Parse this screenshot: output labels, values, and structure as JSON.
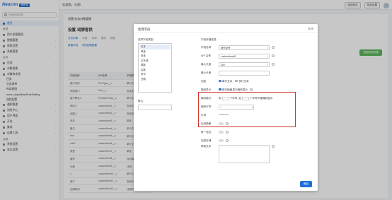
{
  "brand": {
    "logo": "Neocrm",
    "badge": "销售易"
  },
  "sidebar": {
    "search_placeholder": "快速搜索菜单",
    "items": [
      {
        "label": "首页",
        "active": true
      },
      {
        "group": "管理"
      },
      {
        "label": "用户权限管理"
      },
      {
        "label": "数据管理"
      },
      {
        "label": "审批设置"
      },
      {
        "label": "系统管理"
      },
      {
        "group": "定制"
      },
      {
        "label": "应用"
      },
      {
        "label": "对象管理"
      },
      {
        "label": "对象和字段"
      },
      {
        "label": "任务",
        "sub": true
      },
      {
        "label": "业务表单",
        "sub": true
      },
      {
        "label": "布局规则",
        "sub": true
      },
      {
        "label": "menu.objectMaxRuleSetting",
        "sub": true
      },
      {
        "label": "流程配置",
        "sub": true
      },
      {
        "label": "通知管理"
      },
      {
        "label": "消息中心"
      },
      {
        "label": "用户界面"
      },
      {
        "label": "开发"
      },
      {
        "label": "集成"
      },
      {
        "label": "运营工具"
      },
      {
        "group": "设置"
      },
      {
        "label": "系统设置"
      },
      {
        "label": "安全设置"
      }
    ]
  },
  "topbar": {
    "welcome": "欢迎您，小屁!",
    "btn1": "返回首页",
    "btn2": "系统设置"
  },
  "page": {
    "breadcrumb": "设置\\业务对象管理",
    "title": "设置-词牌客供",
    "tabs": [
      "业务对象",
      "字段",
      "布局",
      "规则",
      "按钮"
    ],
    "actions": [
      "新建字段",
      "字段依赖配置"
    ],
    "green_button": "数据权限设置",
    "table_head": [
      "字段名称",
      "API名称",
      "字段类型"
    ],
    "rows": [
      [
        "客户名称",
        "PhoType__c",
        "单行文本"
      ],
      [
        "所属部门",
        "Part__c",
        "查找关系"
      ],
      [
        "客户联系人",
        "PhoNumField__c",
        "单行文本"
      ],
      [
        "修改人",
        "customItem1__c",
        "查找关系"
      ],
      [
        "创建人",
        "customItem2__c",
        "查找关系"
      ],
      [
        "状态",
        "customItem3__c",
        "单选"
      ],
      [
        "备注",
        "customItem4__c",
        "多行文本"
      ],
      [
        "text",
        "customItem5__c",
        "单行文本"
      ],
      [
        "Inkr2",
        "customItem6__c",
        "单行文本"
      ],
      [
        "类型",
        "customItem7__c",
        "单选"
      ],
      [
        "编号",
        "customItem8__c",
        "自动编号"
      ],
      [
        "日期",
        "customItem9__c",
        "日期"
      ],
      [
        "1",
        "customItem10__c",
        "单行文本"
      ],
      [
        "客户",
        "customItem11__c",
        "查找关系"
      ],
      [
        "日期时间",
        "customItem12__c",
        "日期时间"
      ]
    ]
  },
  "modal": {
    "title": "新建字段",
    "close": "关闭",
    "type_label": "选择字段类型:",
    "types": [
      "文本",
      "单选",
      "多选",
      "文本域",
      "整数",
      "实数",
      "货币",
      "日期"
    ],
    "selected_type": "文本",
    "default_label": "默认:",
    "fields": {
      "header": "字段详细信息:",
      "name_label": "字段名称",
      "name_value": "身份证号",
      "api_label": "API 名称",
      "api_value": "customItem48",
      "maxlen_label": "最大长度",
      "maxlen_value": "300",
      "minlen_label": "最小长度",
      "encrypt_label": "加密",
      "encrypt_opt1": "单行文本",
      "encrypt_opt2": "多行文本",
      "mask_label": "掩码显示",
      "mask_opt": "部分掩盖显示掩码显示",
      "mask_format_label": "掩码格式",
      "mask_format_a": "前",
      "mask_format_b": "个字符, 后",
      "mask_format_c": "个字符不隐掩码显示",
      "mask_char_label": "掩码字符",
      "mask_char_value": "*",
      "example_label": "示例",
      "example_value": "**********",
      "required_label": "启用脱敏",
      "unique_label": "唯一验证",
      "hidden_label": "加密存储",
      "help_label": "帮助文本",
      "ok": "确定"
    }
  },
  "colors": {
    "primary": "#1f6fd6",
    "highlight": "#d0352c",
    "success": "#5cb85c"
  }
}
